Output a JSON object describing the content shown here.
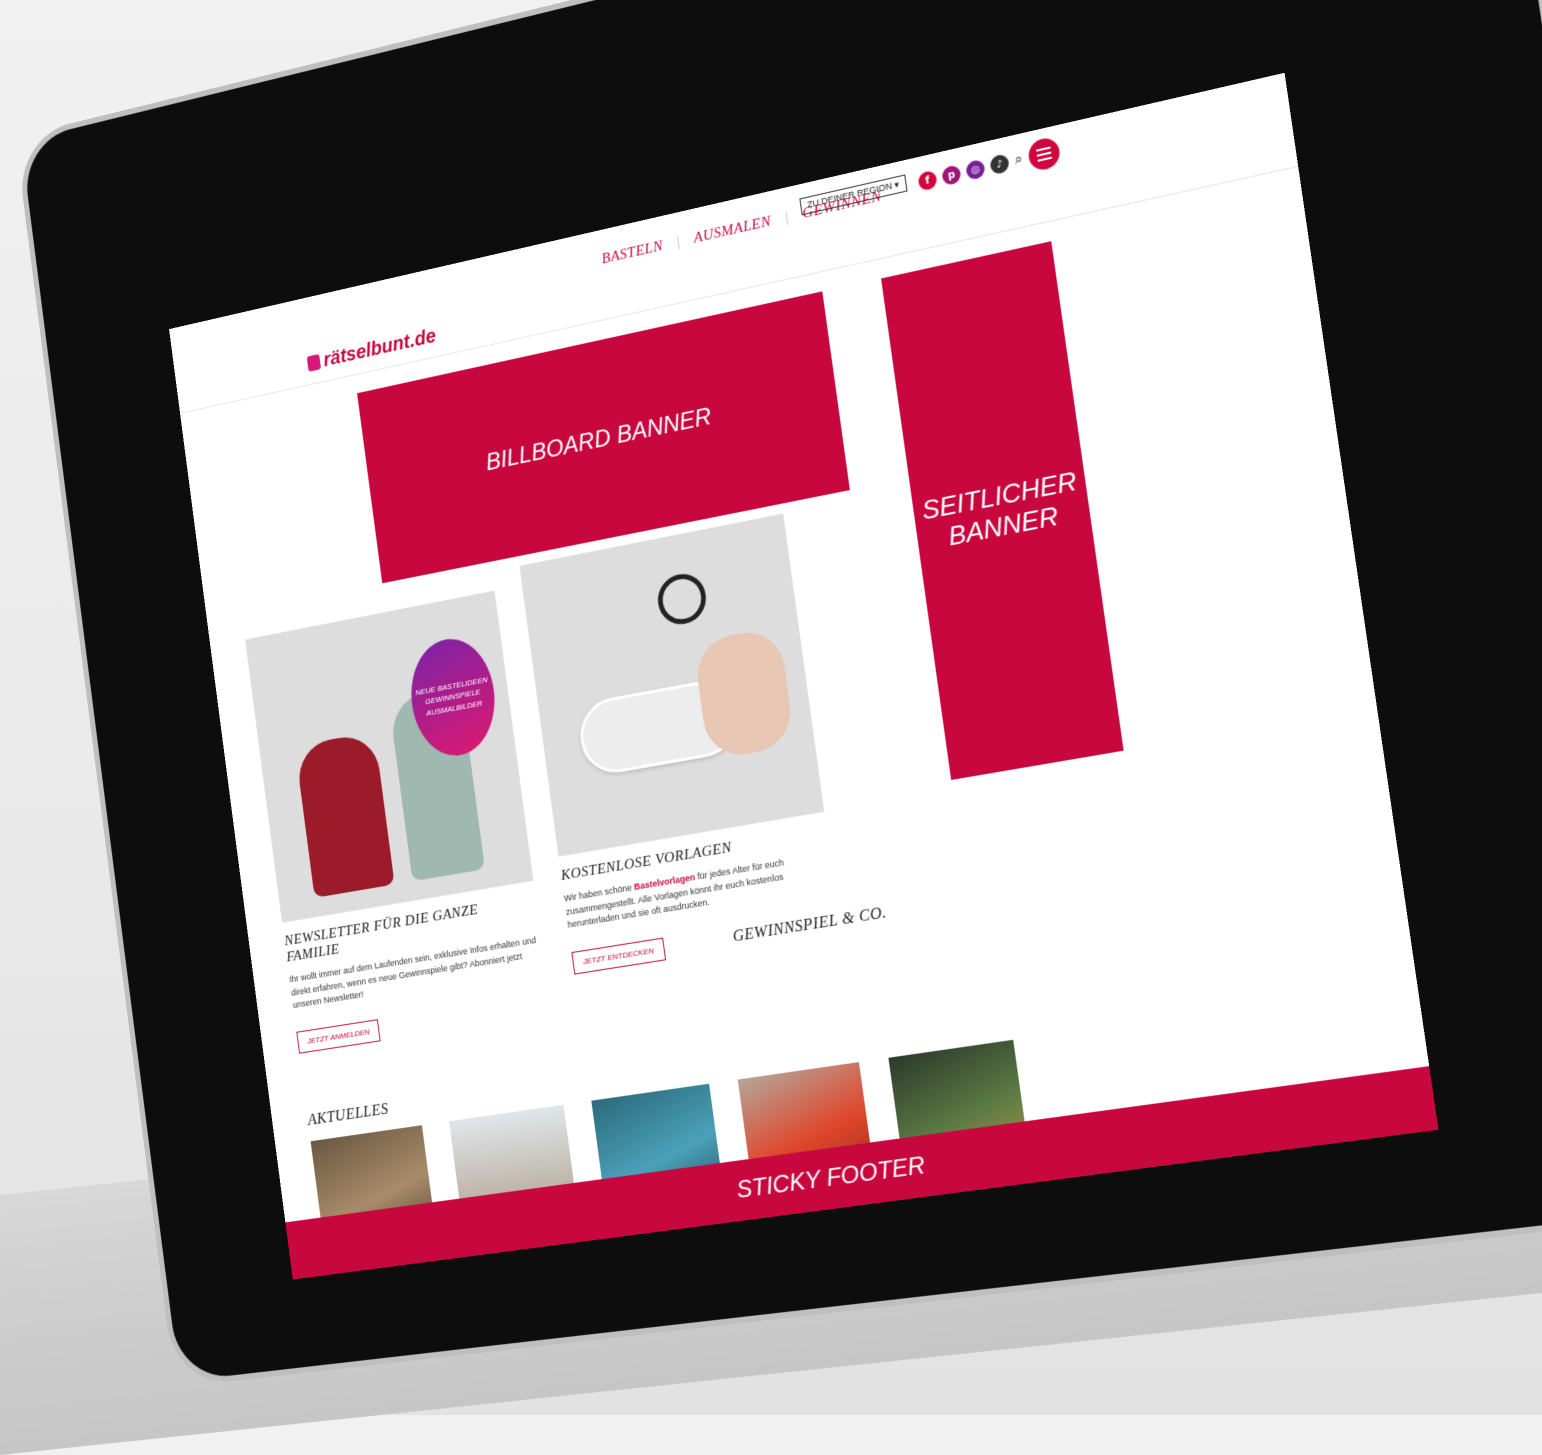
{
  "header": {
    "logo_text": "rätselbunt.de",
    "nav": [
      "BASTELN",
      "AUSMALEN",
      "GEWINNEN"
    ],
    "region_select": "ZU DEINER REGION",
    "social_icons": [
      "facebook-icon",
      "pinterest-icon",
      "instagram-icon",
      "tiktok-icon"
    ],
    "brand_color": "#c9073f"
  },
  "banners": {
    "billboard": "BILLBOARD BANNER",
    "side": "SEITLICHER BANNER",
    "sticky": "STICKY FOOTER"
  },
  "cards": [
    {
      "title": "NEWSLETTER FÜR DIE GANZE FAMILIE",
      "text": "Ihr wollt immer auf dem Laufenden sein, exklusive Infos erhalten und direkt erfahren, wenn es neue Gewinnspiele gibt? Abonniert jetzt unseren Newsletter!",
      "button": "JETZT ANMELDEN",
      "bubble": "NEUE BASTELIDEEN GEWINNSPIELE AUSMALBILDER"
    },
    {
      "title": "KOSTENLOSE VORLAGEN",
      "text_before": "Wir haben schöne ",
      "highlight": "Bastelvorlagen",
      "text_after": " für jedes Alter für euch zusammengestellt. Alle Vorlagen könnt ihr euch kostenlos herunterladen und sie oft ausdrucken.",
      "button": "JETZT ENTDECKEN"
    }
  ],
  "sections": {
    "news": "AKTUELLES",
    "contests": "GEWINNSPIEL & CO."
  }
}
